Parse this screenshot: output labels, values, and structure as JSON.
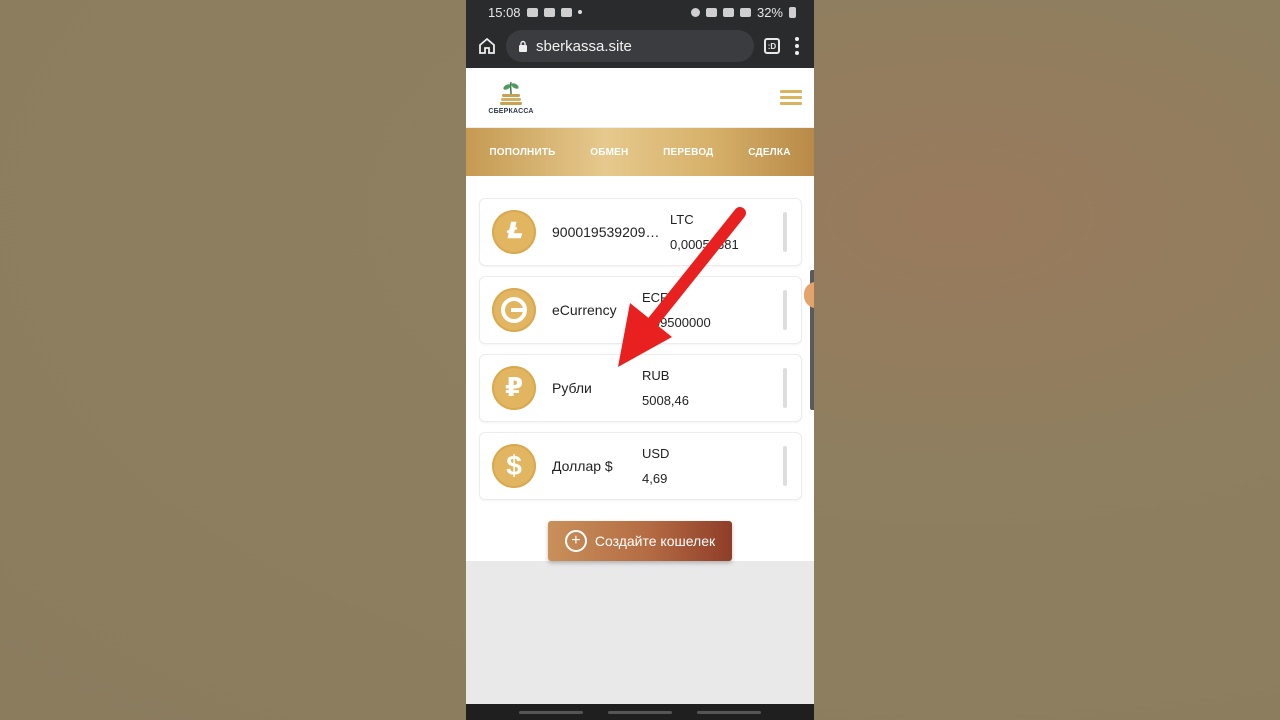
{
  "status_bar": {
    "time": "15:08",
    "battery": "32%"
  },
  "browser": {
    "url": "sberkassa.site",
    "tabs_count": ":D"
  },
  "site": {
    "logo_text": "СБЕРКАССА",
    "nav": [
      "ПОПОЛНИТЬ",
      "ОБМЕН",
      "ПЕРЕВОД",
      "СДЕЛКА"
    ]
  },
  "wallets": [
    {
      "name": "9000195392090...",
      "currency": "LTC",
      "amount": "0,00053681",
      "icon": "litecoin-icon"
    },
    {
      "name": "eCurrency",
      "currency": "ECR",
      "amount": "5,99500000",
      "icon": "ecurrency-icon"
    },
    {
      "name": "Рубли",
      "currency": "RUB",
      "amount": "5008,46",
      "icon": "ruble-icon"
    },
    {
      "name": "Доллар $",
      "currency": "USD",
      "amount": "4,69",
      "icon": "dollar-icon"
    }
  ],
  "create_wallet_label": "Создайте кошелек",
  "colors": {
    "gold": "#e2b561",
    "button_dark": "#8f3d28",
    "arrow": "#e8201f"
  }
}
